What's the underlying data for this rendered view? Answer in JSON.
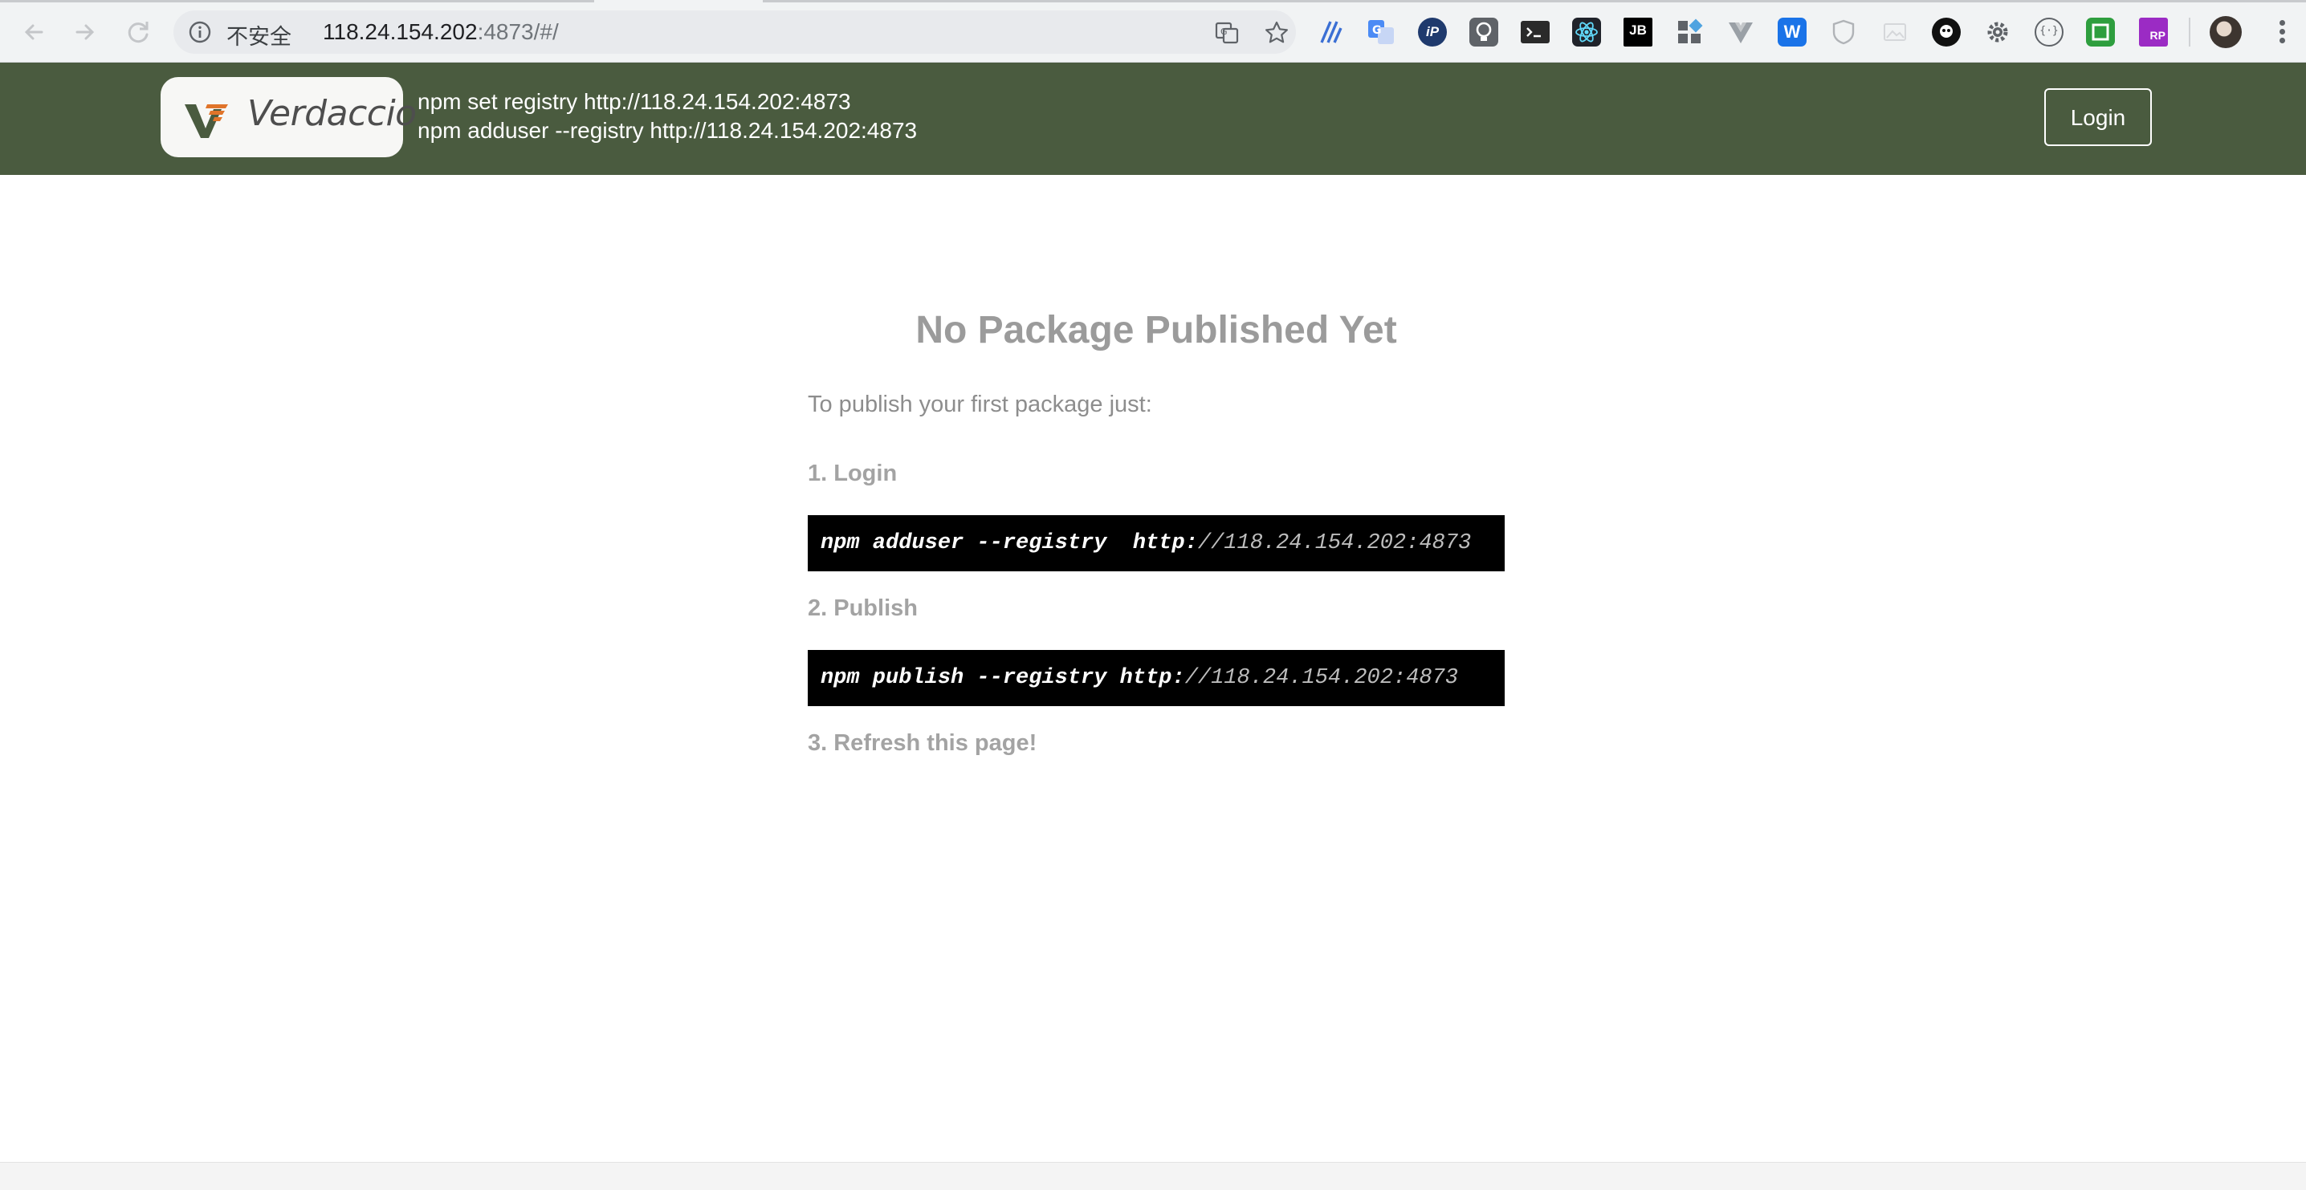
{
  "browser": {
    "security_label": "不安全",
    "url_host": "118.24.154.202",
    "url_rest": ":4873/#/",
    "extensions": [
      "translate-page-icon",
      "bookmark-star-icon",
      "extension-a-icon",
      "google-translate-icon",
      "ip-extension-icon",
      "bulb-extension-icon",
      "terminal-extension-icon",
      "react-devtools-icon",
      "jetbrains-extension-icon",
      "tiles-extension-icon",
      "vue-devtools-icon",
      "w-extension-icon",
      "shield-extension-icon",
      "image-extension-icon",
      "ghost-extension-icon",
      "gear-extension-icon",
      "brackets-extension-icon",
      "square-extension-icon",
      "rp-extension-icon"
    ],
    "extension_labels": {
      "jetbrains": "JB",
      "w": "W",
      "rp": "RP",
      "ip": "iP",
      "brackets": "{·}"
    }
  },
  "header": {
    "brand": "Verdaccio",
    "registry_cmd_set": "npm set registry http://118.24.154.202:4873",
    "registry_cmd_adduser": "npm adduser --registry http://118.24.154.202:4873",
    "login_label": "Login",
    "background_color": "#4a5b3f"
  },
  "main": {
    "title": "No Package Published Yet",
    "intro": "To publish your first package just:",
    "step1_label": "1. Login",
    "step1_cmd_strong": "npm adduser --registry  http:",
    "step1_cmd_dim": "//118.24.154.202:4873",
    "step2_label": "2. Publish",
    "step2_cmd_strong": "npm publish --registry http:",
    "step2_cmd_dim": "//118.24.154.202:4873",
    "step3_label": "3. Refresh this page!"
  }
}
